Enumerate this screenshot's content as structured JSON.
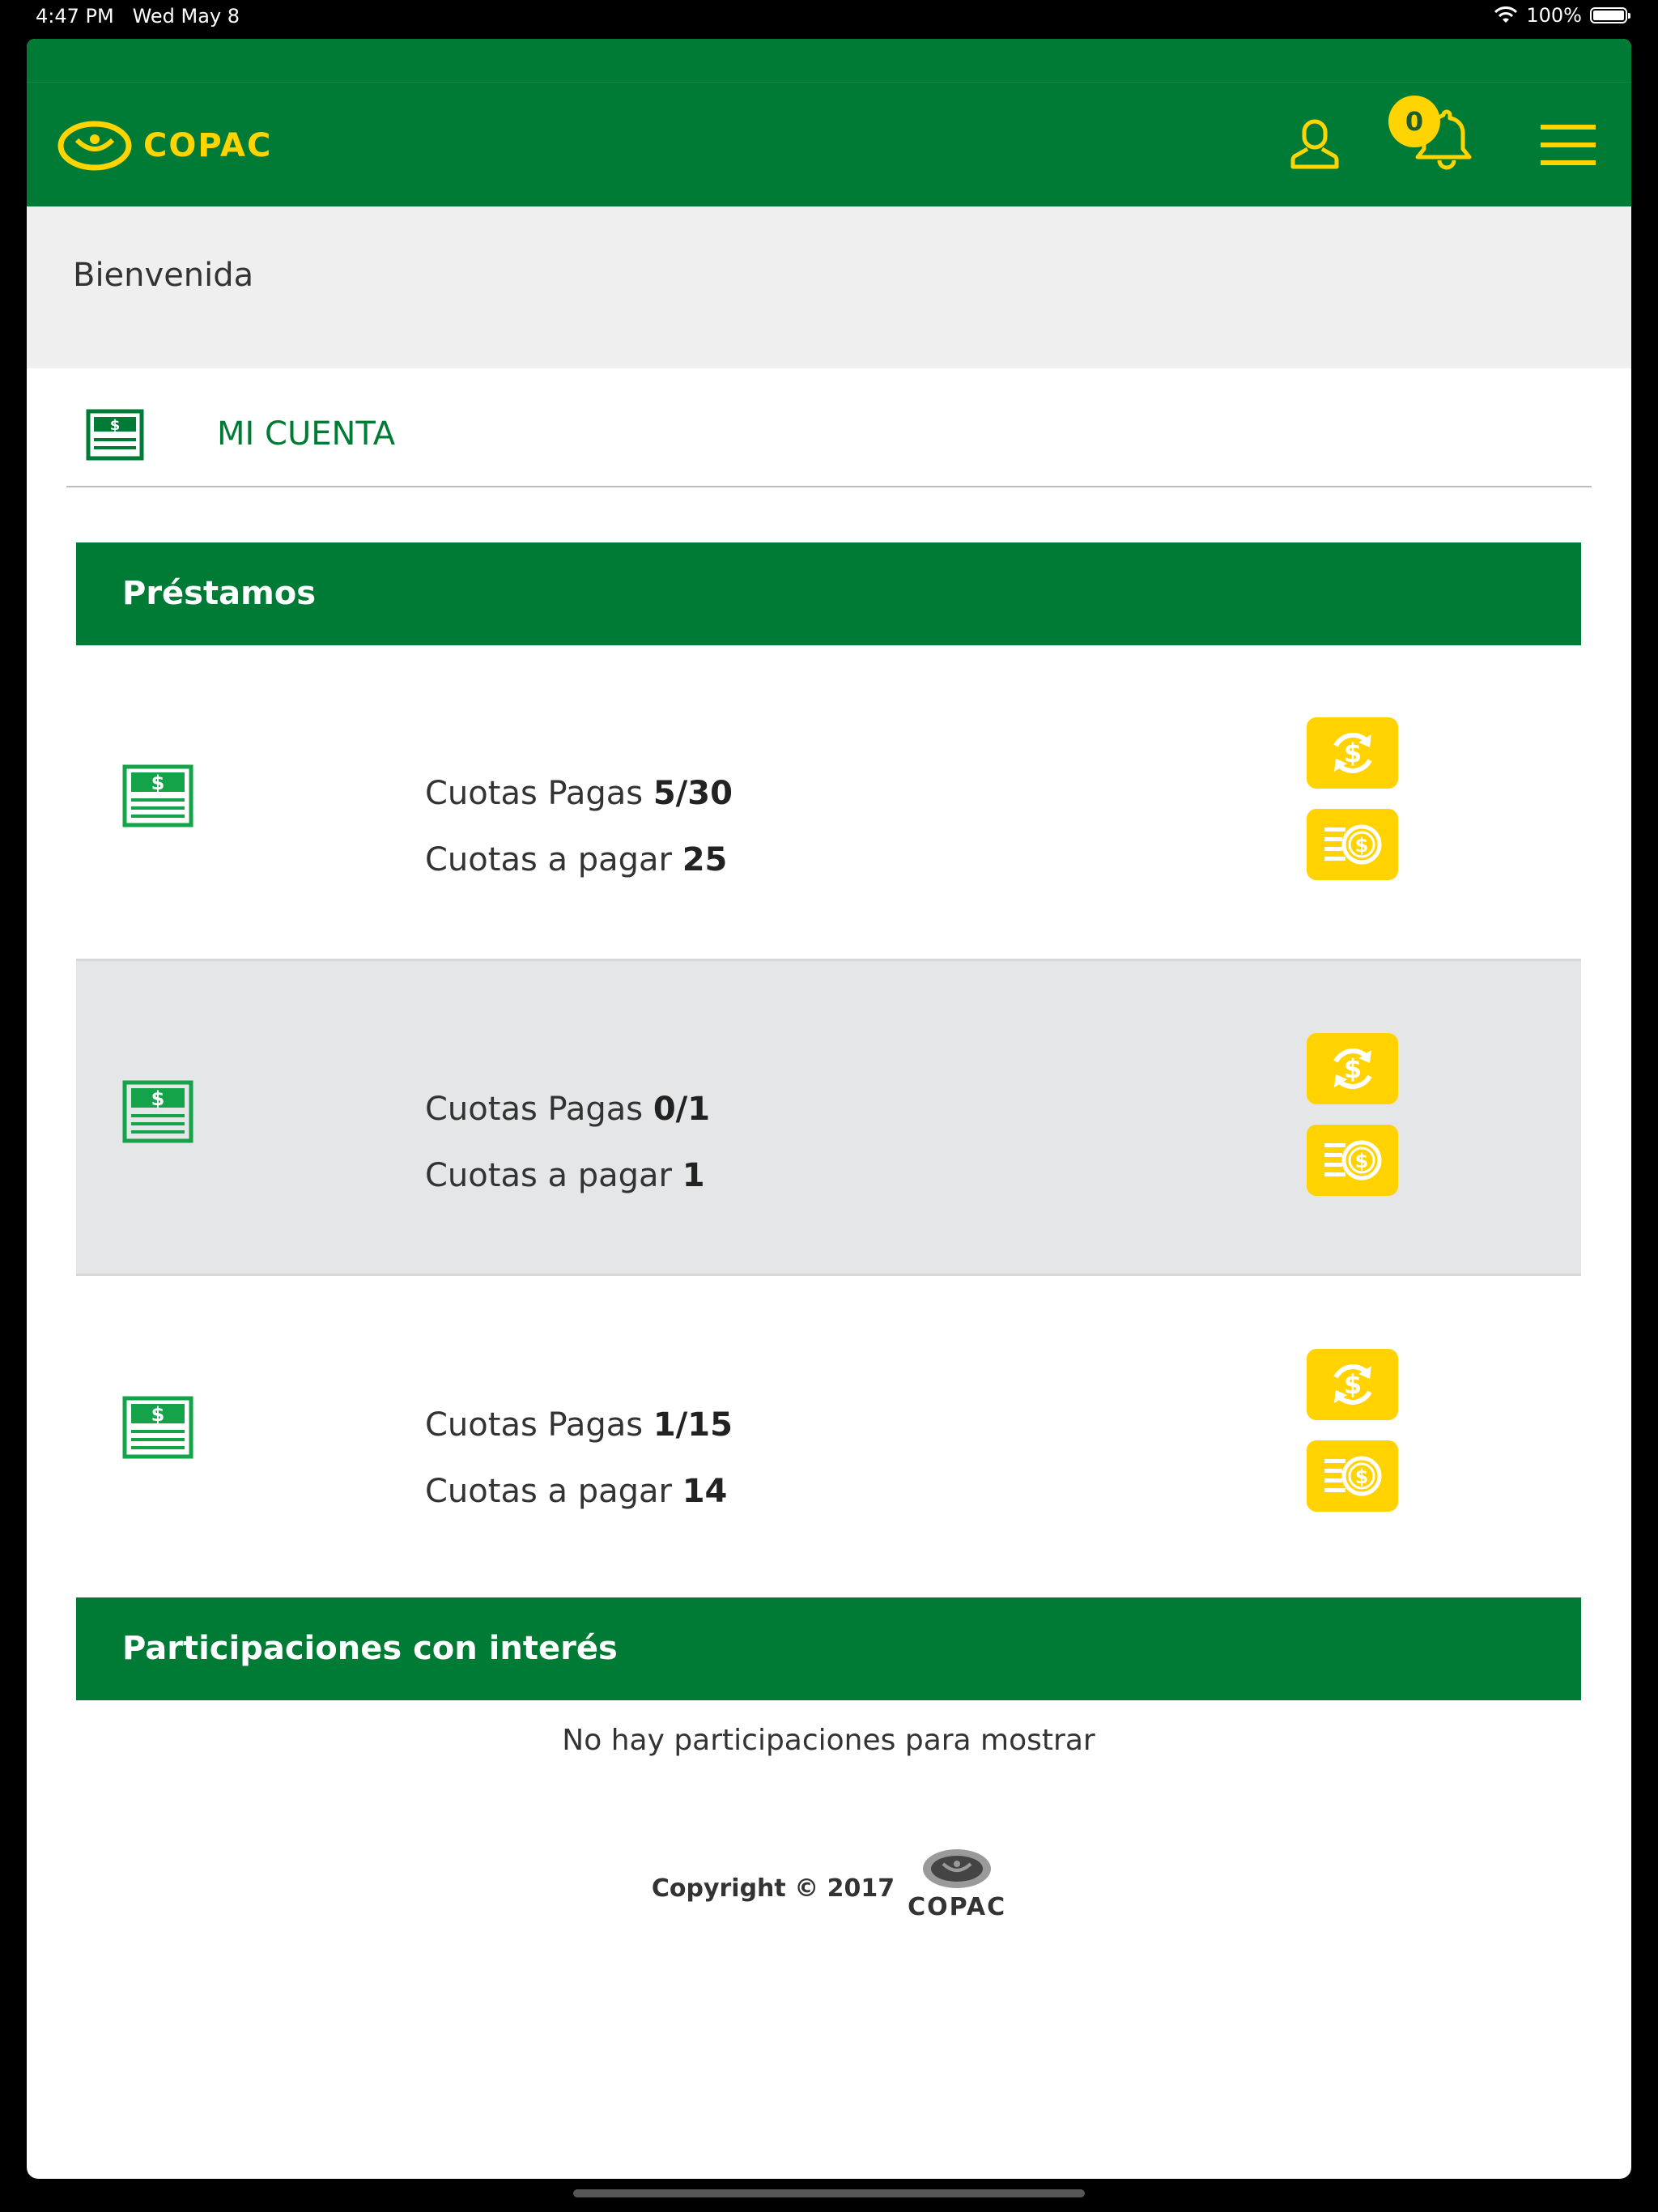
{
  "status_bar": {
    "time": "4:47 PM",
    "date": "Wed May 8",
    "battery": "100%"
  },
  "header": {
    "brand": "COPAC",
    "notifications_count": "0"
  },
  "welcome": {
    "text": "Bienvenida"
  },
  "account": {
    "title": "MI CUENTA"
  },
  "loans": {
    "title": "Préstamos",
    "paid_label": "Cuotas Pagas",
    "due_label": "Cuotas a pagar",
    "items": [
      {
        "paid": "5/30",
        "due": "25"
      },
      {
        "paid": "0/1",
        "due": "1"
      },
      {
        "paid": "1/15",
        "due": "14"
      }
    ]
  },
  "participations": {
    "title": "Participaciones con interés",
    "empty_text": "No hay participaciones para mostrar"
  },
  "footer": {
    "copyright": "Copyright © 2017",
    "brand": "COPAC"
  },
  "colors": {
    "brand_green": "#007b36",
    "accent_yellow": "#ffd200",
    "icon_green": "#15a34a"
  }
}
